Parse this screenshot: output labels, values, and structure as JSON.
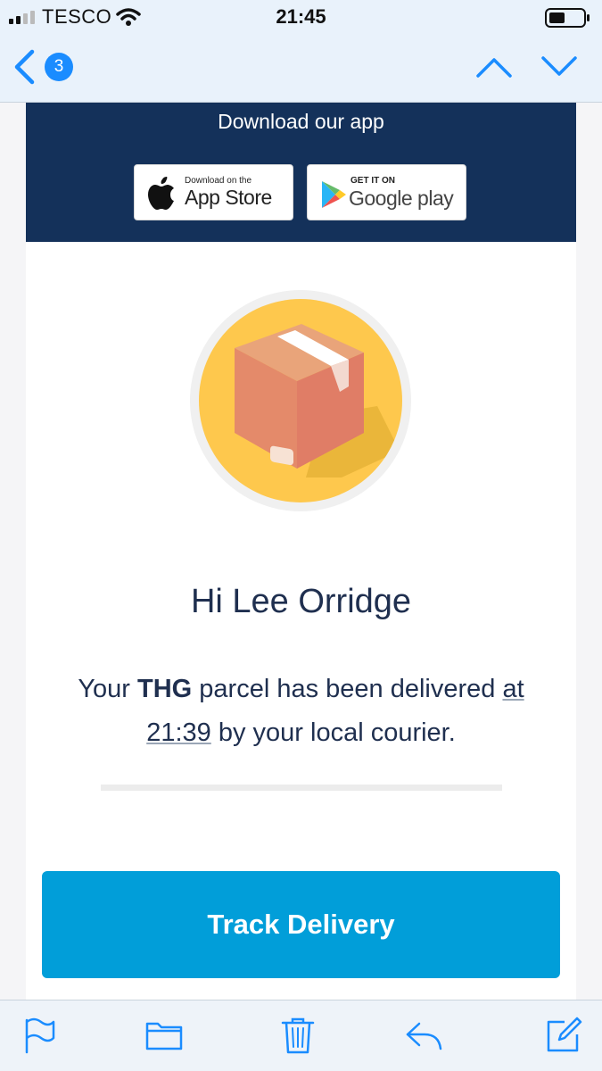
{
  "status_bar": {
    "carrier": "TESCO",
    "time": "21:45"
  },
  "nav": {
    "unread_count": "3",
    "back_icon": "chevron-left-icon",
    "up_icon": "chevron-up-icon",
    "down_icon": "chevron-down-icon"
  },
  "email": {
    "app_banner": {
      "title": "Download our app",
      "appstore_small": "Download on the",
      "appstore_big": "App Store",
      "gplay_small": "GET IT ON",
      "gplay_big": "Google play"
    },
    "greeting": "Hi Lee Orridge",
    "message": {
      "part1": "Your ",
      "brand": "THG",
      "part2": " parcel has been delivered ",
      "link1": "at",
      "link2": "21:39",
      "part3": " by your local courier."
    },
    "button_label": "Track Delivery"
  },
  "toolbar": {
    "icons": [
      "flag-icon",
      "folder-icon",
      "trash-icon",
      "reply-icon",
      "compose-icon"
    ]
  },
  "colors": {
    "banner_bg": "#14315a",
    "button_bg": "#019ed9",
    "accent": "#1a8cff",
    "parcel_circle": "#fec84d",
    "text": "#1f2f4f"
  }
}
